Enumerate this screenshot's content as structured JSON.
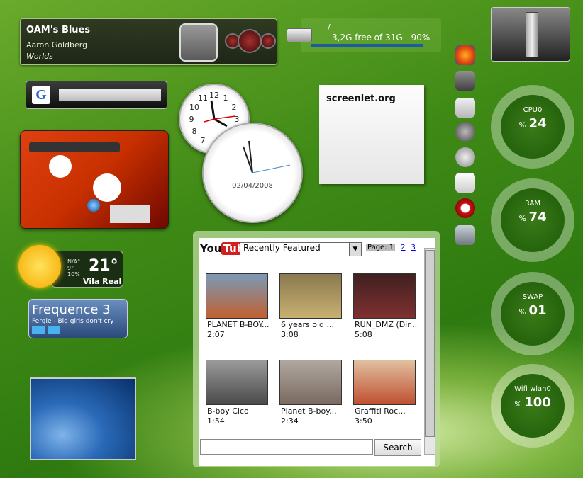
{
  "player": {
    "title": "OAM's Blues",
    "artist": "Aaron Goldberg",
    "album": "Worlds"
  },
  "disk": {
    "path": "/",
    "free_text": "3,2G free of 31G - 90%",
    "used_fraction": 0.9
  },
  "note": {
    "text": "screenlet.org"
  },
  "clock2": {
    "date": "02/04/2008"
  },
  "weather": {
    "temp": "21°",
    "cond": "N/A°",
    "hi": "9°",
    "lo": "10%",
    "city": "Vila Real"
  },
  "radio": {
    "name": "Frequence 3",
    "track": "Fergie - Big girls don't cry"
  },
  "meters": [
    {
      "label": "CPU0",
      "value": "24"
    },
    {
      "label": "RAM",
      "value": "74"
    },
    {
      "label": "SWAP",
      "value": "01"
    },
    {
      "label": "Wifi wlan0",
      "value": "100"
    }
  ],
  "youtube": {
    "logo_a": "You",
    "logo_b": "Tube",
    "category": "Recently Featured",
    "page_label": "Page: 1",
    "pages": [
      "2",
      "3"
    ],
    "search_label": "Search",
    "videos": [
      {
        "title": "PLANET B-BOY...",
        "duration": "2:07",
        "color": "#7a9ab8"
      },
      {
        "title": "6 years old ...",
        "duration": "3:08",
        "color": "#c8b070"
      },
      {
        "title": "RUN_DMZ (Dir...",
        "duration": "5:08",
        "color": "#402020"
      },
      {
        "title": "B-boy Cico",
        "duration": "1:54",
        "color": "#6a6a6a"
      },
      {
        "title": "Planet B-boy...",
        "duration": "2:34",
        "color": "#9a8a80"
      },
      {
        "title": "Graffiti Roc...",
        "duration": "3:50",
        "color": "#c05030"
      }
    ]
  },
  "icons": [
    "firefox-icon",
    "nvidia-icon",
    "folder-icon",
    "media-icon",
    "music-icon",
    "document-icon",
    "vodafone-icon",
    "users-icon"
  ],
  "icon_colors": [
    "#e06010",
    "#506050",
    "#d8d8d8",
    "#606060",
    "#b0b0b0",
    "#f0f0f0",
    "#d01010",
    "#a0a8b0"
  ]
}
